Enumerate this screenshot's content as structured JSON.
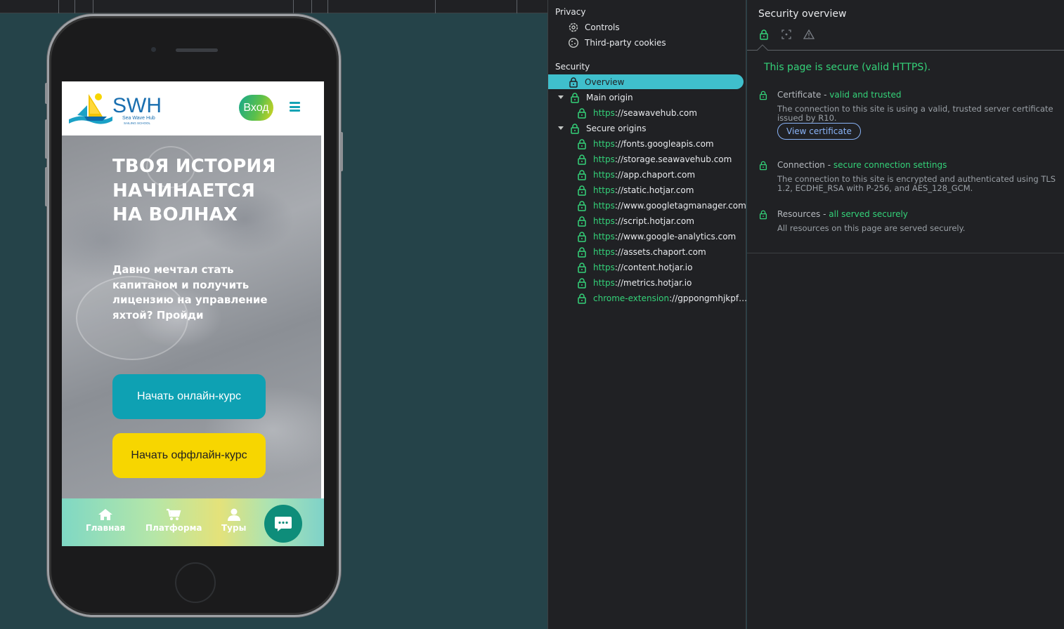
{
  "colors": {
    "preview_bg": "#254349",
    "devtools_bg": "#202124",
    "secure_green": "#34d279",
    "selected_row": "#3fbfcc",
    "link_blue": "#8ab4f8",
    "cta_online": "#0ea1b3",
    "cta_offline": "#f7d600"
  },
  "site": {
    "logo_text": "SWH",
    "logo_subtext": "Sea Wave Hub",
    "logo_subtext2": "SAILING SCHOOL",
    "login_label": "Вход",
    "hero_title_line1": "ТВОЯ ИСТОРИЯ",
    "hero_title_line2": "НАЧИНАЕТСЯ",
    "hero_title_line3": "НА ВОЛНАХ",
    "hero_subtitle": "Давно мечтал стать капитаном и получить лицензию на управление яхтой? Пройди",
    "cta_online": "Начать онлайн-курс",
    "cta_offline": "Начать оффлайн-курс",
    "bottom_nav": [
      {
        "label": "Главная",
        "icon": "home-icon"
      },
      {
        "label": "Платформа",
        "icon": "cart-icon"
      },
      {
        "label": "Туры",
        "icon": "user-icon"
      }
    ],
    "chat_icon": "chat-icon"
  },
  "sidebar": {
    "privacy_title": "Privacy",
    "privacy_items": [
      {
        "label": "Controls",
        "icon": "gear-icon"
      },
      {
        "label": "Third-party cookies",
        "icon": "cookie-icon"
      }
    ],
    "security_title": "Security",
    "overview_label": "Overview",
    "main_origin_label": "Main origin",
    "main_origin": {
      "scheme": "https",
      "host": "://seawavehub.com"
    },
    "secure_origins_label": "Secure origins",
    "secure_origins": [
      {
        "scheme": "https",
        "host": "://fonts.googleapis.com"
      },
      {
        "scheme": "https",
        "host": "://storage.seawavehub.com"
      },
      {
        "scheme": "https",
        "host": "://app.chaport.com"
      },
      {
        "scheme": "https",
        "host": "://static.hotjar.com"
      },
      {
        "scheme": "https",
        "host": "://www.googletagmanager.com"
      },
      {
        "scheme": "https",
        "host": "://script.hotjar.com"
      },
      {
        "scheme": "https",
        "host": "://www.google-analytics.com"
      },
      {
        "scheme": "https",
        "host": "://assets.chaport.com"
      },
      {
        "scheme": "https",
        "host": "://content.hotjar.io"
      },
      {
        "scheme": "https",
        "host": "://metrics.hotjar.io"
      },
      {
        "scheme": "chrome-extension",
        "host": "://gppongmhjkpf…"
      }
    ]
  },
  "panel": {
    "title": "Security overview",
    "tabs": [
      "lock-icon",
      "info-icon",
      "warning-icon"
    ],
    "headline": "This page is secure (valid HTTPS).",
    "certificate": {
      "prefix": "Certificate - ",
      "status": "valid and trusted",
      "description": "The connection to this site is using a valid, trusted server certificate issued by R10.",
      "button": "View certificate"
    },
    "connection": {
      "prefix": "Connection - ",
      "status": "secure connection settings",
      "description": "The connection to this site is encrypted and authenticated using TLS 1.2, ECDHE_RSA with P-256, and AES_128_GCM."
    },
    "resources": {
      "prefix": "Resources - ",
      "status": "all served securely",
      "description": "All resources on this page are served securely."
    }
  }
}
